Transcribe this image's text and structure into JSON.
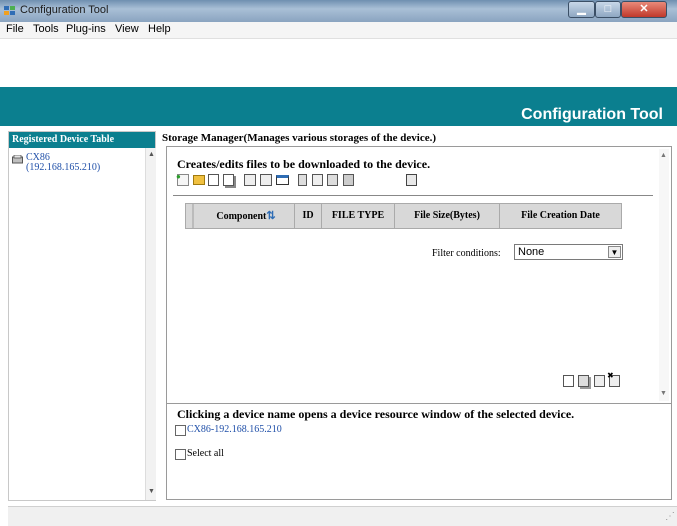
{
  "window": {
    "title": "Configuration Tool"
  },
  "menu": [
    "File",
    "Tools",
    "Plug-ins",
    "View",
    "Help"
  ],
  "banner": {
    "title": "Configuration Tool"
  },
  "left_panel": {
    "header": "Registered Device Table",
    "device": {
      "name": "CX86",
      "ip": "(192.168.165.210)"
    }
  },
  "right_panel": {
    "title": "Storage Manager(Manages various storages of the device.)",
    "section_heading": "Creates/edits files to be downloaded to the device.",
    "table": {
      "columns": [
        "Component",
        "ID",
        "FILE TYPE",
        "File Size(Bytes)",
        "File Creation Date"
      ]
    },
    "filter": {
      "label": "Filter conditions:",
      "value": "None"
    },
    "devices_note": "Clicking a device name opens a device resource window of the selected device.",
    "device_checkbox_label": "CX86-192.168.165.210",
    "select_all_label": "Select all"
  },
  "colors": {
    "banner": "#0b7f8f",
    "link": "#1f4fa8"
  }
}
